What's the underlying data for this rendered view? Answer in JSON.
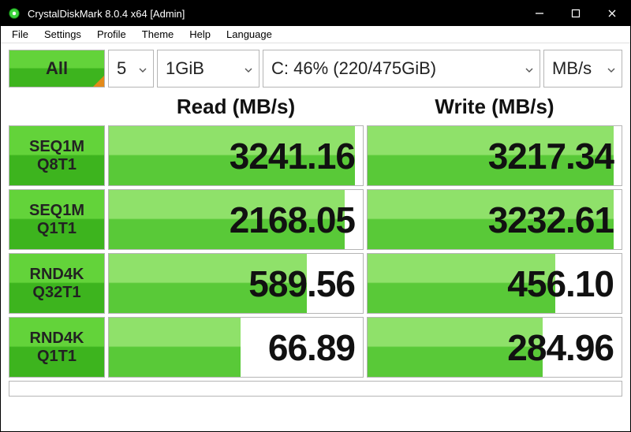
{
  "window": {
    "title": "CrystalDiskMark 8.0.4 x64 [Admin]"
  },
  "menu": [
    "File",
    "Settings",
    "Profile",
    "Theme",
    "Help",
    "Language"
  ],
  "controls": {
    "all_label": "All",
    "runs": "5",
    "size": "1GiB",
    "drive": "C: 46% (220/475GiB)",
    "unit": "MB/s"
  },
  "headers": {
    "read": "Read (MB/s)",
    "write": "Write (MB/s)"
  },
  "rows": [
    {
      "l1": "SEQ1M",
      "l2": "Q8T1",
      "read": "3241.16",
      "read_pct": 97,
      "write": "3217.34",
      "write_pct": 97
    },
    {
      "l1": "SEQ1M",
      "l2": "Q1T1",
      "read": "2168.05",
      "read_pct": 93,
      "write": "3232.61",
      "write_pct": 97
    },
    {
      "l1": "RND4K",
      "l2": "Q32T1",
      "read": "589.56",
      "read_pct": 78,
      "write": "456.10",
      "write_pct": 74
    },
    {
      "l1": "RND4K",
      "l2": "Q1T1",
      "read": "66.89",
      "read_pct": 52,
      "write": "284.96",
      "write_pct": 69
    }
  ]
}
